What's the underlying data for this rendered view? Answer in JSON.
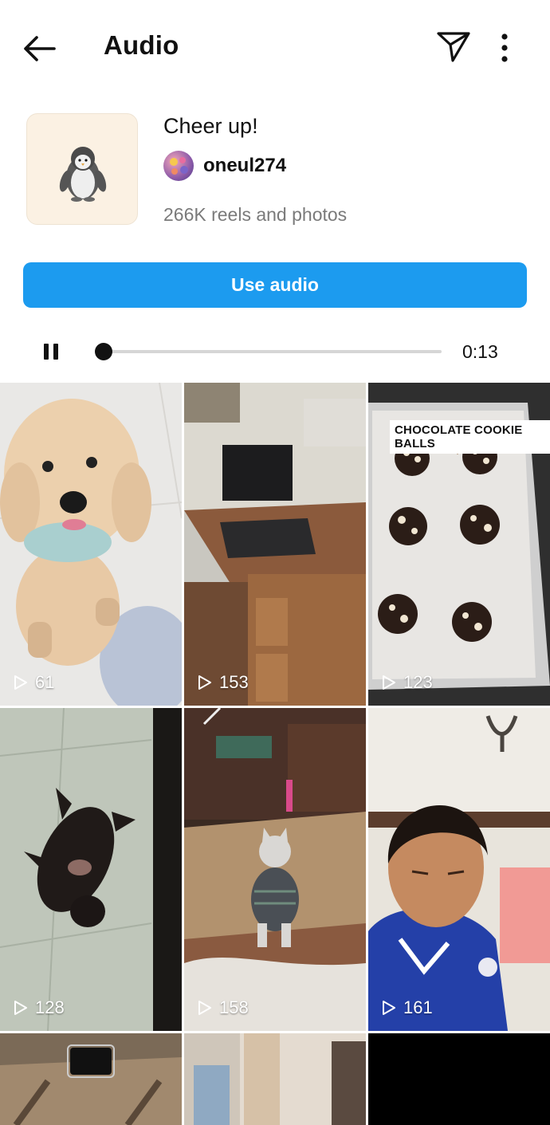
{
  "header": {
    "title": "Audio",
    "back_icon": "arrow-left-icon",
    "send_icon": "paper-plane-icon",
    "more_icon": "more-vertical-icon"
  },
  "audio": {
    "title": "Cheer up!",
    "artist": "oneul274",
    "reels_count": "266K reels and photos",
    "cover_icon": "penguin-icon"
  },
  "actions": {
    "use_audio_label": "Use audio"
  },
  "player": {
    "state": "playing",
    "pause_icon": "pause-icon",
    "elapsed": "0:13",
    "progress": 0.0
  },
  "colors": {
    "accent": "#1c9bef",
    "muted_text": "#7a7a7a"
  },
  "reels": [
    {
      "views": "61",
      "subject": "poodle dog"
    },
    {
      "views": "153",
      "subject": "computer desk"
    },
    {
      "views": "123",
      "subject": "chocolate cookie balls",
      "sticker": "CHOCOLATE COOKIE BALLS"
    },
    {
      "views": "128",
      "subject": "black kitten"
    },
    {
      "views": "158",
      "subject": "cat in sweater"
    },
    {
      "views": "161",
      "subject": "boy in jersey"
    },
    {
      "views": "",
      "subject": "room"
    },
    {
      "views": "",
      "subject": "window"
    },
    {
      "views": "",
      "subject": "black"
    }
  ]
}
